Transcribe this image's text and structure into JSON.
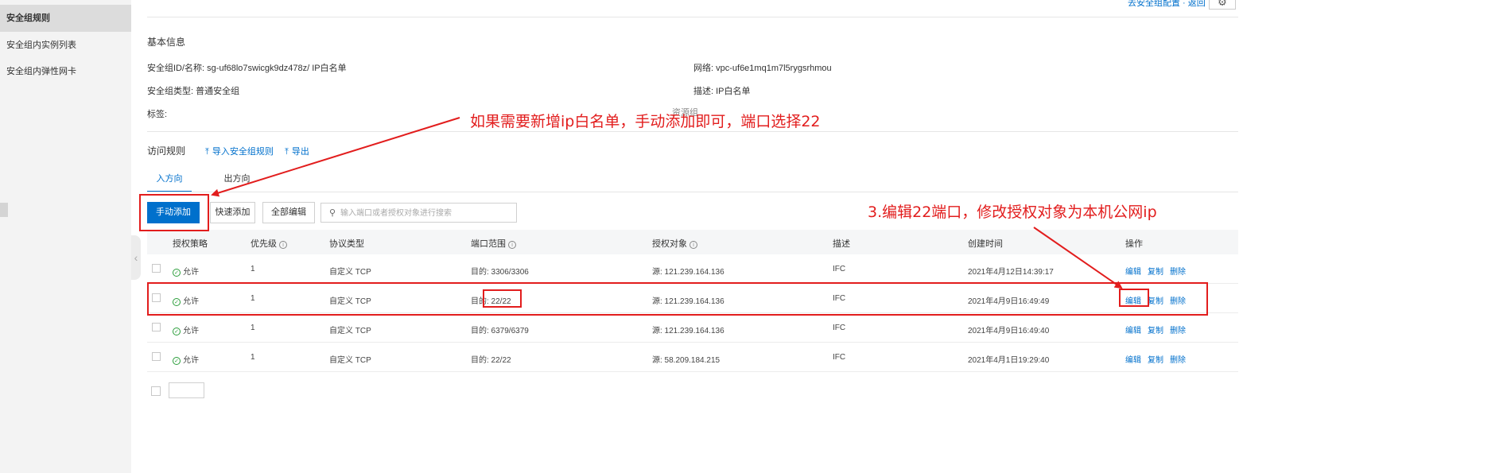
{
  "sidebar": {
    "items": [
      {
        "label": "安全组规则",
        "active": true
      },
      {
        "label": "安全组内实例列表",
        "active": false
      },
      {
        "label": "安全组内弹性网卡",
        "active": false
      }
    ]
  },
  "top": {
    "links": "去安全组配置 · 返回"
  },
  "basic_info": {
    "title": "基本信息",
    "id_name": "安全组ID/名称:  sg-uf68lo7swicgk9dz478z/ IP白名单",
    "type": "安全组类型:  普通安全组",
    "tags": "标签:",
    "network": "网络:  vpc-uf6e1mq1m7l5rygsrhmou",
    "description": "描述:  IP白名单",
    "resource_group": "资源组"
  },
  "rules": {
    "title": "访问规则",
    "import_link": "导入安全组规则",
    "export_link": "导出",
    "tabs": [
      "入方向",
      "出方向"
    ],
    "buttons": {
      "manual_add": "手动添加",
      "quick_add": "快速添加",
      "edit_all": "全部编辑"
    },
    "search_placeholder": "输入端口或者授权对象进行搜索",
    "columns": [
      "授权策略",
      "优先级",
      "协议类型",
      "端口范围",
      "授权对象",
      "描述",
      "创建时间",
      "操作"
    ],
    "rows": [
      {
        "policy": "允许",
        "priority": "1",
        "protocol": "自定义 TCP",
        "port": "目的: 3306/3306",
        "source": "源: 121.239.164.136",
        "desc": "IFC",
        "created": "2021年4月12日14:39:17"
      },
      {
        "policy": "允许",
        "priority": "1",
        "protocol": "自定义 TCP",
        "port": "目的: 22/22",
        "source": "源: 121.239.164.136",
        "desc": "IFC",
        "created": "2021年4月9日16:49:49"
      },
      {
        "policy": "允许",
        "priority": "1",
        "protocol": "自定义 TCP",
        "port": "目的: 6379/6379",
        "source": "源: 121.239.164.136",
        "desc": "IFC",
        "created": "2021年4月9日16:49:40"
      },
      {
        "policy": "允许",
        "priority": "1",
        "protocol": "自定义 TCP",
        "port": "目的: 22/22",
        "source": "源: 58.209.184.215",
        "desc": "IFC",
        "created": "2021年4月1日19:29:40"
      }
    ],
    "ops": {
      "edit": "编辑",
      "copy": "复制",
      "delete": "删除"
    }
  },
  "annotations": {
    "note1": "如果需要新增ip白名单，手动添加即可，端口选择22",
    "note2": "3.编辑22端口，修改授权对象为本机公网ip",
    "color": "#e21d1d"
  },
  "colors": {
    "accent": "#0070cc",
    "allow": "#2a9d3a"
  },
  "icons": {
    "import": "upload-icon",
    "export": "upload-icon",
    "search": "search-icon",
    "info": "info-icon",
    "allow": "check-circle-icon",
    "settings": "gear-icon"
  }
}
